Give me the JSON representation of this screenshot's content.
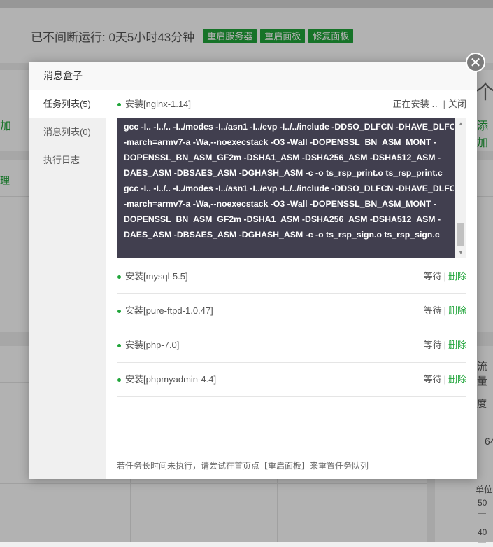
{
  "background": {
    "runtime": "已不间断运行: 0天5小时43分钟",
    "buttons": [
      "重启服务器",
      "重启面板",
      "修复面板"
    ],
    "left_add": "加",
    "left_manage": "理",
    "right_add": "添加",
    "right_char": "个",
    "right_volume": "流量",
    "right_speed": "度",
    "right_value": "64",
    "right_unit": "单位",
    "axis_50": "50 —",
    "axis_40": "40 —"
  },
  "modal": {
    "title": "消息盒子",
    "close_symbol": "✕",
    "tabs": [
      "任务列表(5)",
      "消息列表(0)",
      "执行日志"
    ],
    "active_task": {
      "name": "安装[nginx-1.14]",
      "status": "正在安装 ‥",
      "close_label": "关闭",
      "separator": "|"
    },
    "console_lines": [
      "gcc -I.. -I../.. -I../modes -I../asn1 -I../evp -I../../include -DDSO_DLFCN -DHAVE_DLFCN_H",
      "-march=armv7-a -Wa,--noexecstack -O3 -Wall -DOPENSSL_BN_ASM_MONT -",
      "DOPENSSL_BN_ASM_GF2m -DSHA1_ASM -DSHA256_ASM -DSHA512_ASM -",
      "DAES_ASM -DBSAES_ASM -DGHASH_ASM -c -o ts_rsp_print.o ts_rsp_print.c",
      "gcc -I.. -I../.. -I../modes -I../asn1 -I../evp -I../../include -DDSO_DLFCN -DHAVE_DLFCN_H",
      "-march=armv7-a -Wa,--noexecstack -O3 -Wall -DOPENSSL_BN_ASM_MONT -",
      "DOPENSSL_BN_ASM_GF2m -DSHA1_ASM -DSHA256_ASM -DSHA512_ASM -",
      "DAES_ASM -DBSAES_ASM -DGHASH_ASM -c -o ts_rsp_sign.o ts_rsp_sign.c"
    ],
    "queued_tasks": [
      {
        "name": "安装[mysql-5.5]",
        "wait": "等待",
        "sep": "|",
        "delete": "删除"
      },
      {
        "name": "安装[pure-ftpd-1.0.47]",
        "wait": "等待",
        "sep": "|",
        "delete": "删除"
      },
      {
        "name": "安装[php-7.0]",
        "wait": "等待",
        "sep": "|",
        "delete": "删除"
      },
      {
        "name": "安装[phpmyadmin-4.4]",
        "wait": "等待",
        "sep": "|",
        "delete": "删除"
      }
    ],
    "tip": "若任务长时间未执行，请尝试在首页点【重启面板】来重置任务队列"
  },
  "colors": {
    "accent": "#20a53a",
    "console_bg": "#413f4f"
  }
}
